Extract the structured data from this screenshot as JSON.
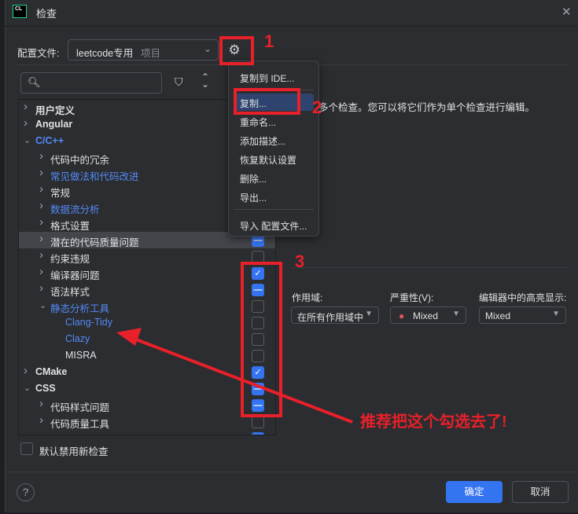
{
  "window": {
    "title": "检查",
    "app_icon": "CL",
    "close_icon": "close-icon"
  },
  "profile": {
    "label": "配置文件:",
    "value": "leetcode专用",
    "scope": "项目"
  },
  "toolbar": {
    "filter_icon": "filter-icon",
    "expand_icon": "expand-collapse-icon"
  },
  "tree": [
    {
      "label": "用户定义",
      "level": 0,
      "expanded": false,
      "bold": true,
      "blue": false,
      "check": null
    },
    {
      "label": "Angular",
      "level": 0,
      "expanded": false,
      "bold": true,
      "blue": false,
      "check": null
    },
    {
      "label": "C/C++",
      "level": 0,
      "expanded": true,
      "bold": true,
      "blue": true,
      "check": null
    },
    {
      "label": "代码中的冗余",
      "level": 1,
      "expanded": false,
      "blue": false,
      "check": null
    },
    {
      "label": "常见做法和代码改进",
      "level": 1,
      "expanded": false,
      "blue": true,
      "check": null
    },
    {
      "label": "常规",
      "level": 1,
      "expanded": false,
      "blue": false,
      "check": null
    },
    {
      "label": "数据流分析",
      "level": 1,
      "expanded": false,
      "blue": true,
      "check": null
    },
    {
      "label": "格式设置",
      "level": 1,
      "expanded": false,
      "blue": false,
      "check": null
    },
    {
      "label": "潜在的代码质量问题",
      "level": 1,
      "expanded": false,
      "blue": false,
      "check": "partial",
      "selected": true
    },
    {
      "label": "约束违规",
      "level": 1,
      "expanded": false,
      "blue": false,
      "check": "off"
    },
    {
      "label": "编译器问题",
      "level": 1,
      "expanded": false,
      "blue": false,
      "check": "on"
    },
    {
      "label": "语法样式",
      "level": 1,
      "expanded": false,
      "blue": false,
      "check": "partial"
    },
    {
      "label": "静态分析工具",
      "level": 1,
      "expanded": true,
      "blue": true,
      "check": "off"
    },
    {
      "label": "Clang-Tidy",
      "level": 2,
      "leaf": true,
      "blue": true,
      "check": "off"
    },
    {
      "label": "Clazy",
      "level": 2,
      "leaf": true,
      "blue": true,
      "check": "off"
    },
    {
      "label": "MISRA",
      "level": 2,
      "leaf": true,
      "blue": false,
      "check": "off"
    },
    {
      "label": "CMake",
      "level": 0,
      "expanded": false,
      "bold": true,
      "blue": false,
      "check": "on"
    },
    {
      "label": "CSS",
      "level": 0,
      "expanded": true,
      "bold": true,
      "blue": false,
      "check": "partial"
    },
    {
      "label": "代码样式问题",
      "level": 1,
      "expanded": false,
      "blue": false,
      "check": "partial"
    },
    {
      "label": "代码质量工具",
      "level": 1,
      "expanded": false,
      "blue": false,
      "check": "off"
    },
    {
      "label": "",
      "level": 1,
      "expanded": false,
      "blue": false,
      "check": "on"
    }
  ],
  "description": "多个检查。您可以将它们作为单个检查进行编辑。",
  "options": {
    "scope_label": "作用域:",
    "scope_value": "在所有作用域中",
    "severity_label": "严重性(V):",
    "severity_value": "Mixed",
    "highlight_label": "编辑器中的高亮显示:",
    "highlight_value": "Mixed"
  },
  "menu": {
    "items": [
      "复制到 IDE...",
      "复制...",
      "重命名...",
      "添加描述...",
      "恢复默认设置",
      "删除...",
      "导出...",
      "导入 配置文件..."
    ],
    "highlighted": 1
  },
  "footer": {
    "disable_new_label": "默认禁用新检查",
    "help": "?",
    "ok": "确定",
    "cancel": "取消"
  },
  "annotations": {
    "n1": "1",
    "n2": "2",
    "n3": "3",
    "note": "推荐把这个勾选去了!",
    "color": "#e8202a"
  }
}
